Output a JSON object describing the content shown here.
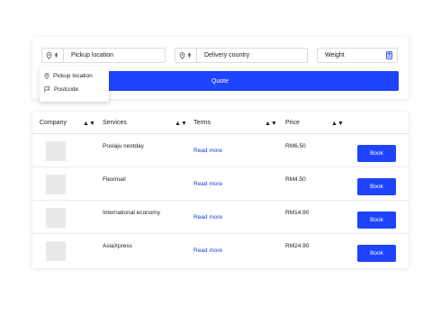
{
  "quote_form": {
    "pickup": {
      "label": "Pickup location",
      "icon": "map-pin-icon"
    },
    "delivery": {
      "label": "Delivery country",
      "icon": "map-pin-icon"
    },
    "weight": {
      "label": "Weight",
      "icon": "calculator-icon"
    },
    "quote_button_label": "Quote"
  },
  "location_dropdown": {
    "items": [
      {
        "label": "Pickup location",
        "icon": "map-pin-icon"
      },
      {
        "label": "Postcode",
        "icon": "flag-icon"
      }
    ]
  },
  "table": {
    "headers": {
      "company": "Company",
      "services": "Services",
      "terms": "Terms",
      "price": "Price"
    },
    "rows": [
      {
        "service": "Poslaju nextday",
        "terms": "Read more",
        "price": "RM6.50",
        "action": "Book"
      },
      {
        "service": "Fleximail",
        "terms": "Read more",
        "price": "RM4.50",
        "action": "Book"
      },
      {
        "service": "International economy",
        "terms": "Read more",
        "price": "RM14.90",
        "action": "Book"
      },
      {
        "service": "AsiaXpress",
        "terms": "Read more",
        "price": "RM24.90",
        "action": "Book"
      }
    ]
  },
  "colors": {
    "accent": "#1e44ff",
    "link": "#1a3fd8",
    "placeholder": "#e9e9e9"
  }
}
